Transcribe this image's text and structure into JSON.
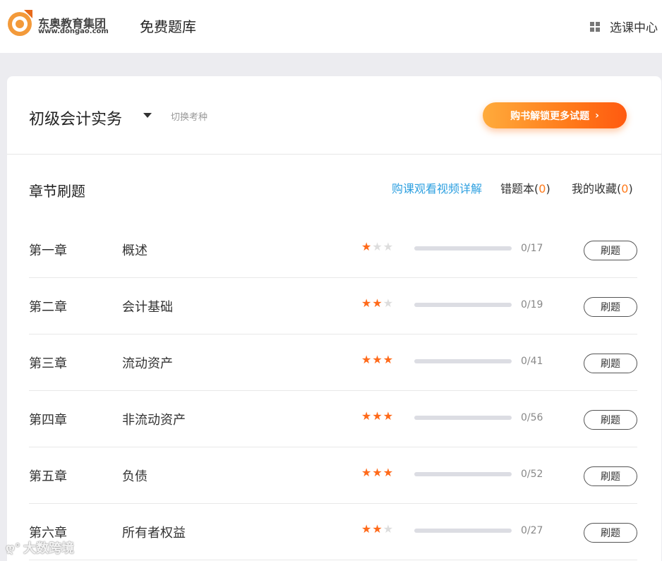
{
  "header": {
    "logo_cn": "东奥教育集团",
    "logo_en": "www.dongao.com",
    "site_title": "免费题库",
    "course_center": "选课中心",
    "course_center_icon": "grid-icon"
  },
  "subject": {
    "name": "初级会计实务",
    "switch_label": "切换考种",
    "unlock_label": "购书解锁更多试题",
    "unlock_icon": "chevron-right-icon"
  },
  "section": {
    "title": "章节刷题",
    "video_link": "购课观看视频详解",
    "wrong_book_label": "错题本(",
    "wrong_book_count": "0",
    "favorites_label": "我的收藏(",
    "favorites_count": "0",
    "close_paren": ")"
  },
  "chapters": [
    {
      "no": "第一章",
      "name": "概述",
      "stars": 1,
      "progress_fraction": 0,
      "progress": "0/17",
      "button": "刷题"
    },
    {
      "no": "第二章",
      "name": "会计基础",
      "stars": 2,
      "progress_fraction": 0,
      "progress": "0/19",
      "button": "刷题"
    },
    {
      "no": "第三章",
      "name": "流动资产",
      "stars": 3,
      "progress_fraction": 0,
      "progress": "0/41",
      "button": "刷题"
    },
    {
      "no": "第四章",
      "name": "非流动资产",
      "stars": 3,
      "progress_fraction": 0,
      "progress": "0/56",
      "button": "刷题"
    },
    {
      "no": "第五章",
      "name": "负债",
      "stars": 3,
      "progress_fraction": 0,
      "progress": "0/52",
      "button": "刷题"
    },
    {
      "no": "第六章",
      "name": "所有者权益",
      "stars": 2,
      "progress_fraction": 0,
      "progress": "0/27",
      "button": "刷题"
    }
  ],
  "colors": {
    "accent": "#ff7a1a",
    "link": "#2ea0e0",
    "star_on": "#ff6a1a",
    "star_off": "#dddddd"
  },
  "watermark": {
    "text": "大数跨境"
  }
}
